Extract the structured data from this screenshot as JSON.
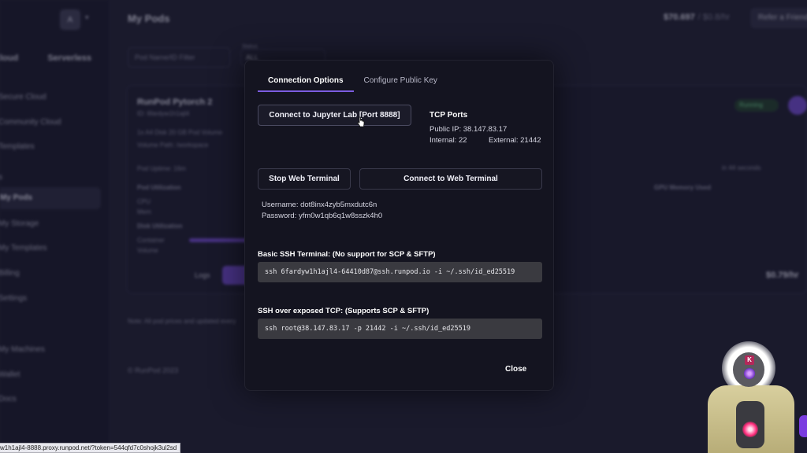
{
  "background": {
    "sidebar": {
      "avatar_letter": "A",
      "tabs": [
        "Cloud",
        "Serverless"
      ],
      "items": [
        {
          "label": "Secure Cloud"
        },
        {
          "label": "Community Cloud"
        },
        {
          "label": "Templates"
        },
        {
          "label": "s"
        },
        {
          "label": "My Pods"
        },
        {
          "label": "My Storage"
        },
        {
          "label": "My Templates"
        },
        {
          "label": "Billing"
        },
        {
          "label": "Settings"
        },
        {
          "label": "My Machines"
        },
        {
          "label": "Wallet"
        },
        {
          "label": "Docs"
        }
      ]
    },
    "header": {
      "title": "My Pods",
      "balance": "$70.697",
      "balance_sub": "/ $0.8/hr",
      "refer_label": "Refer a Friend"
    },
    "filters": {
      "filter_placeholder": "Pod Name/ID Filter",
      "status_label": "Status",
      "status_value": "ALL"
    },
    "pod": {
      "name": "RunPod Pytorch 2",
      "id_line": "ID: 6fardyw1h1ajl4",
      "specs_line": "1x A4 Disk   20 GB Pod Volume",
      "volume_path": "Volume Path: /workspace",
      "uptime": "Pod Uptime: 16m",
      "utilization_label": "Pod Utilization",
      "cpu_label": "CPU",
      "mem_label": "Mem",
      "disk_label": "Disk Utilization",
      "container_label": "Container",
      "volume_label": "Volume",
      "status": "Running",
      "gpu_mem_label": "GPU Memory Used",
      "logs_label": "Logs",
      "price": "$0.79/hr",
      "refresh_label": "in 44 seconds"
    },
    "note": "Note: All pod prices and updated every",
    "copyright": "© RunPod 2023"
  },
  "modal": {
    "tabs": [
      {
        "label": "Connection Options",
        "active": true
      },
      {
        "label": "Configure Public Key",
        "active": false
      }
    ],
    "jupyter_button": "Connect to Jupyter Lab [Port 8888]",
    "tcp": {
      "title": "TCP Ports",
      "public_ip": "Public IP: 38.147.83.17",
      "internal": "Internal: 22",
      "external": "External: 21442"
    },
    "stop_terminal_button": "Stop Web Terminal",
    "connect_terminal_button": "Connect to Web Terminal",
    "username": "Username: dot8inx4zyb5mxdutc6n",
    "password": "Password: yfm0w1qb6q1w8sszk4h0",
    "ssh_basic_title": "Basic SSH Terminal: (No support for SCP & SFTP)",
    "ssh_basic_cmd": "ssh 6fardyw1h1ajl4-64410d87@ssh.runpod.io -i ~/.ssh/id_ed25519",
    "ssh_tcp_title": "SSH over exposed TCP: (Supports SCP & SFTP)",
    "ssh_tcp_cmd": "ssh root@38.147.83.17 -p 21442 -i ~/.ssh/id_ed25519",
    "close_button": "Close"
  },
  "status_url": "w1h1ajl4-8888.proxy.runpod.net/?token=544qfd7c0shojk3ul2sd",
  "colors": {
    "accent": "#7c5ce0",
    "modal_bg": "#141420",
    "code_bg": "#3a3a40"
  }
}
